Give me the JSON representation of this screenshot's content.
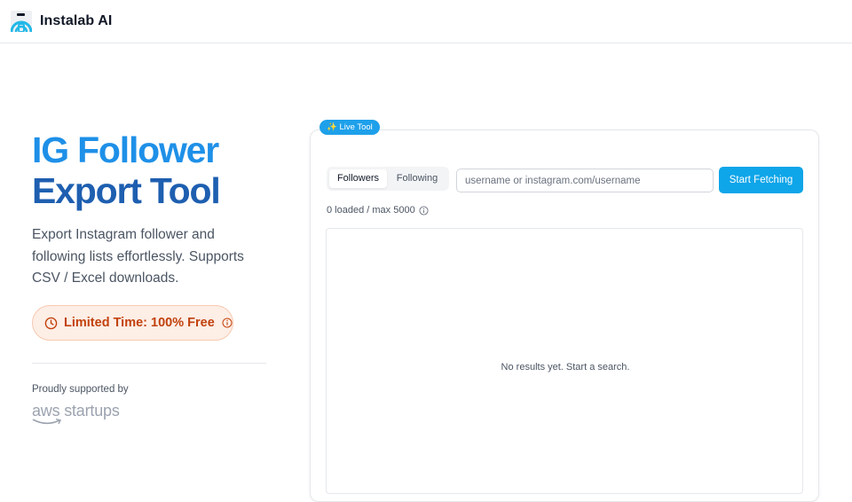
{
  "header": {
    "brand": "Instalab AI",
    "logo_icon": "instalab-logo-icon"
  },
  "hero": {
    "title_line1": "IG Follower",
    "title_line2": "Export Tool",
    "description": "Export Instagram follower and following lists effortlessly. Supports CSV / Excel downloads.",
    "promo": "Limited Time: 100% Free",
    "supported_label": "Proudly supported by",
    "sponsor_logo_text": "aws startups"
  },
  "tool": {
    "badge": "✨ Live Tool",
    "tabs": [
      {
        "label": "Followers",
        "active": true
      },
      {
        "label": "Following",
        "active": false
      }
    ],
    "search_placeholder": "username or instagram.com/username",
    "search_value": "",
    "fetch_label": "Start Fetching",
    "count_text": "0 loaded / max 5000",
    "empty_text": "No results yet. Start a search."
  },
  "colors": {
    "accent": "#0ea5e9",
    "title_blue": "#1e90e8",
    "title_dark_blue": "#1e5fb0",
    "promo_text": "#c2410c",
    "promo_bg": "#fdeee6"
  }
}
